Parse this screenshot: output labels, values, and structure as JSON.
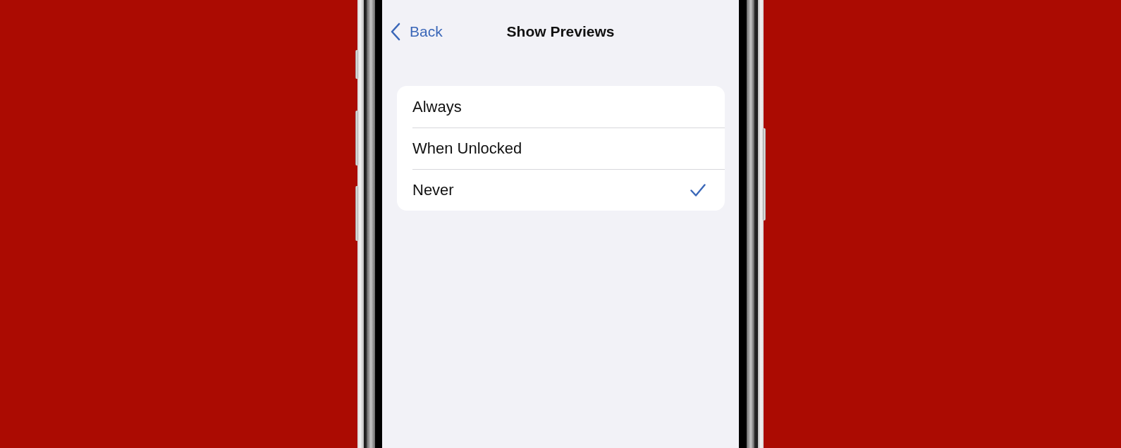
{
  "nav": {
    "back_label": "Back",
    "title": "Show Previews"
  },
  "options": [
    {
      "label": "Always",
      "selected": false
    },
    {
      "label": "When Unlocked",
      "selected": false
    },
    {
      "label": "Never",
      "selected": true
    }
  ]
}
